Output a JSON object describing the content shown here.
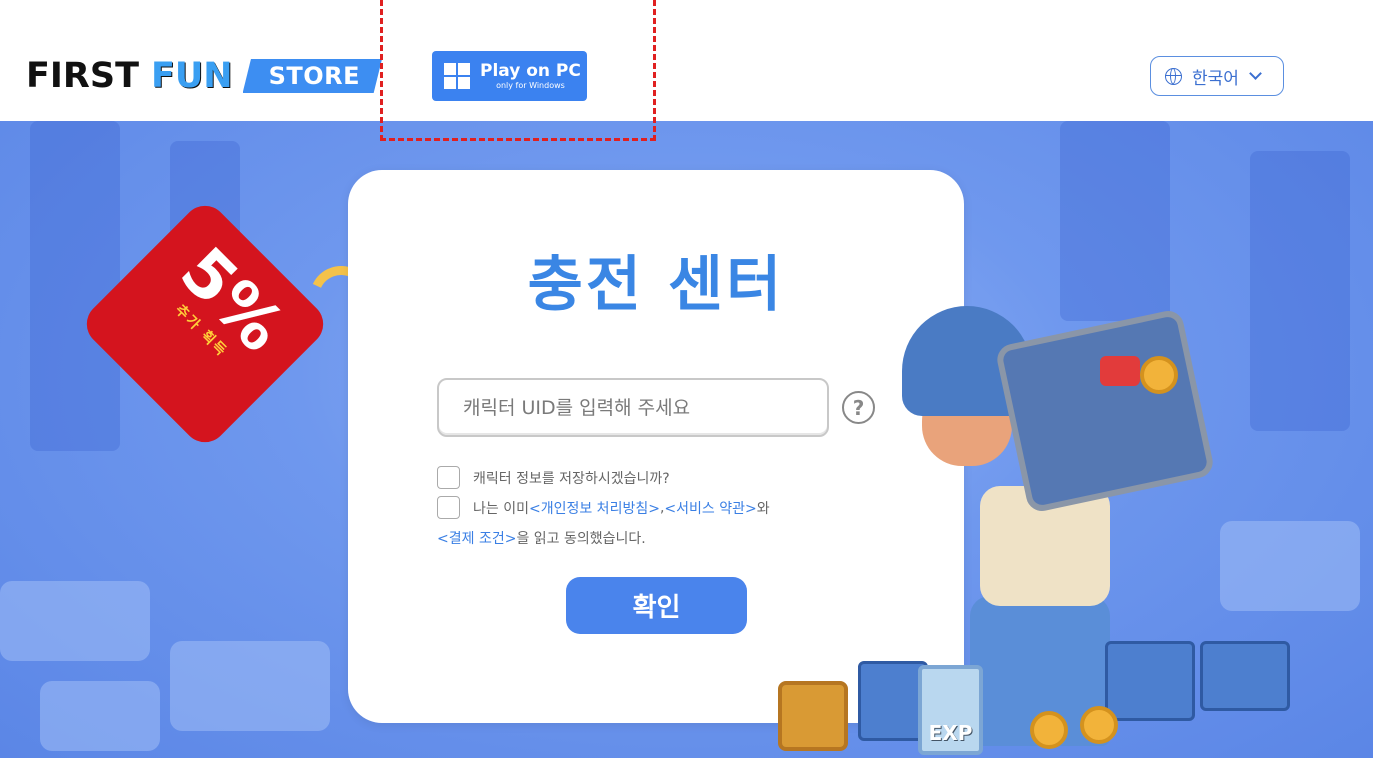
{
  "header": {
    "logo_first": "FIRST",
    "logo_fun": "FUN",
    "logo_store": "STORE",
    "play_main": "Play on PC",
    "play_sub": "only for Windows",
    "language": "한국어"
  },
  "card": {
    "title": "충전 센터",
    "uid_placeholder": "캐릭터 UID를 입력해 주세요",
    "help": "?",
    "save_info_label": "캐릭터 정보를 저장하시겠습니까?",
    "agree_prefix": "나는 이미 ",
    "privacy_link": "<개인정보 처리방침>",
    "comma": ",",
    "service_link": "<서비스 약관>",
    "agree_and": "와",
    "payment_link": "<결제 조건>",
    "agree_suffix": "을 읽고 동의했습니다.",
    "confirm_label": "확인"
  },
  "promo": {
    "percent": "5%",
    "sub": "추가 획득"
  },
  "decor": {
    "exp_label": "EXP"
  },
  "colors": {
    "accent": "#3a86e4",
    "badge": "#d4141e",
    "button": "#4a84ec"
  }
}
